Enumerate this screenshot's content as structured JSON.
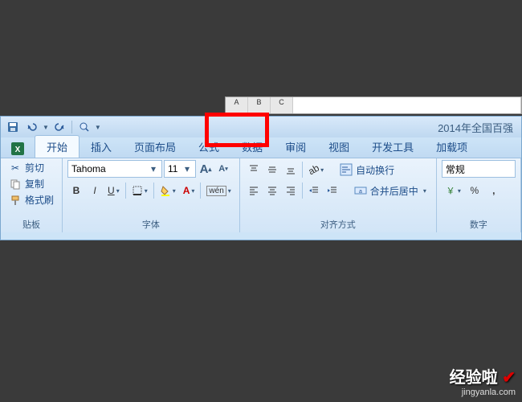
{
  "title": "2014年全国百强",
  "qat": {
    "save": "save-icon",
    "undo": "undo-icon",
    "redo": "redo-icon",
    "print": "print-preview-icon"
  },
  "tabs": [
    {
      "label": "开始",
      "active": true
    },
    {
      "label": "插入"
    },
    {
      "label": "页面布局"
    },
    {
      "label": "公式"
    },
    {
      "label": "数据"
    },
    {
      "label": "审阅"
    },
    {
      "label": "视图"
    },
    {
      "label": "开发工具"
    },
    {
      "label": "加载项"
    }
  ],
  "clipboard": {
    "cut": "剪切",
    "copy": "复制",
    "paste": "格式刷",
    "group_label": "贴板"
  },
  "font": {
    "name": "Tahoma",
    "size": "11",
    "grow": "A",
    "shrink": "A",
    "bold": "B",
    "italic": "I",
    "underline": "U",
    "phonetic": "wén",
    "group_label": "字体"
  },
  "alignment": {
    "wrap": "自动换行",
    "merge": "合并后居中",
    "group_label": "对齐方式"
  },
  "number": {
    "format": "常规",
    "percent": "%",
    "comma": ",",
    "group_label": "数字"
  },
  "sheet": {
    "cols": [
      "A",
      "B",
      "C"
    ]
  },
  "watermark": {
    "text": "经验啦",
    "url": "jingyanla.com"
  }
}
